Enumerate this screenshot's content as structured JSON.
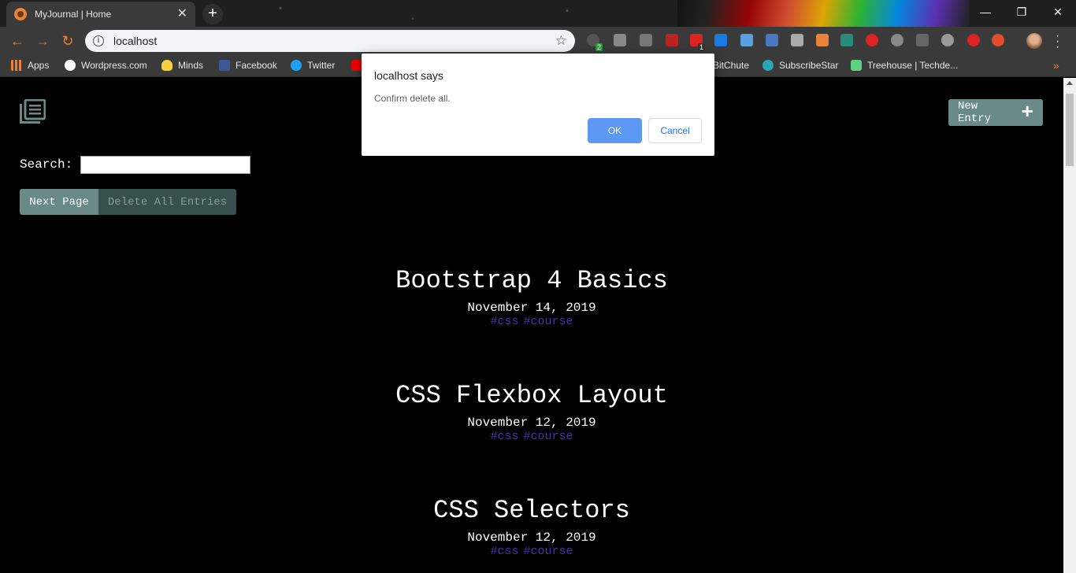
{
  "browser": {
    "tab_title": "MyJournal | Home",
    "tab_close": "✕",
    "new_tab": "+",
    "window_controls": {
      "minimize": "—",
      "restore": "❐",
      "close": "✕"
    },
    "nav": {
      "back": "←",
      "forward": "→",
      "reload": "↻"
    },
    "url": "localhost",
    "info_glyph": "i",
    "star": "☆",
    "extension_badges": [
      "2",
      "1"
    ],
    "bookmarks": [
      {
        "label": "Apps",
        "icon": "apps-grid-icon",
        "color": "#e8833a"
      },
      {
        "label": "Wordpress.com",
        "icon": "wordpress-icon",
        "color": "#ffffff"
      },
      {
        "label": "Minds",
        "icon": "lightbulb-icon",
        "color": "#f5d142"
      },
      {
        "label": "Facebook",
        "icon": "facebook-icon",
        "color": "#3b5998"
      },
      {
        "label": "Twitter",
        "icon": "twitter-icon",
        "color": "#1da1f2"
      },
      {
        "label": "BitChute",
        "icon": "bitchute-icon",
        "color": "#e03c31"
      },
      {
        "label": "SubscribeStar",
        "icon": "subscribestar-icon",
        "color": "#2aa8b8"
      },
      {
        "label": "Treehouse | Techde...",
        "icon": "treehouse-icon",
        "color": "#5fcf80"
      }
    ],
    "bookmarks_more": "»"
  },
  "page": {
    "search_label": "Search:",
    "search_value": "",
    "new_entry_label": "New Entry",
    "new_entry_plus": "+",
    "next_page_label": "Next Page",
    "delete_all_label": "Delete All Entries",
    "entries": [
      {
        "title": "Bootstrap 4 Basics",
        "date": "November 14, 2019",
        "tags": [
          "#css",
          "#course"
        ]
      },
      {
        "title": "CSS Flexbox Layout",
        "date": "November 12, 2019",
        "tags": [
          "#css",
          "#course"
        ]
      },
      {
        "title": "CSS Selectors",
        "date": "November 12, 2019",
        "tags": [
          "#css",
          "#course"
        ]
      }
    ]
  },
  "dialog": {
    "title": "localhost says",
    "message": "Confirm delete all.",
    "ok_label": "OK",
    "cancel_label": "Cancel"
  },
  "colors": {
    "accent_button": "#6a8a87",
    "disabled_button": "#35504d",
    "tag_color": "#4a2fb0",
    "dialog_ok": "#5e98f5",
    "chrome_accent": "#e8833a"
  }
}
